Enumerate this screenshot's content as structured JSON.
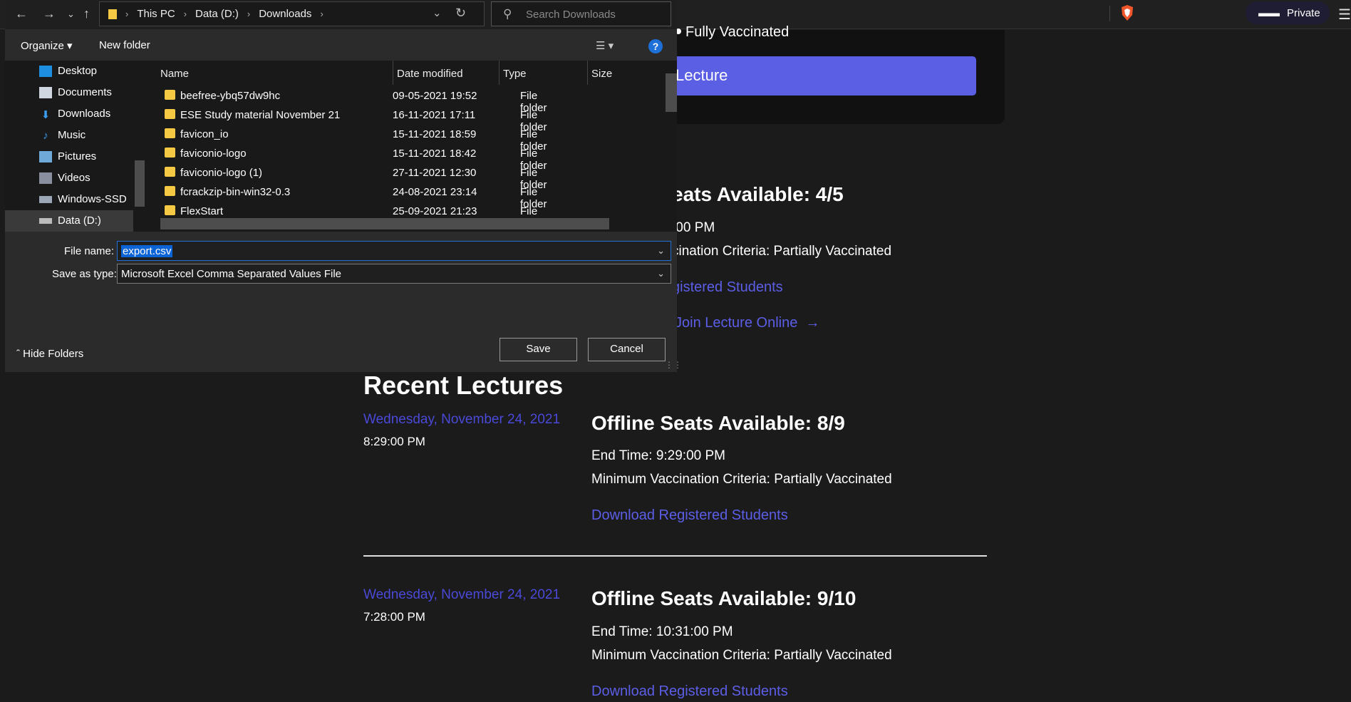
{
  "browser": {
    "private_label": "Private"
  },
  "page": {
    "partial_status": "Fully Vaccinated",
    "lecture_button": "Lecture",
    "upcoming": {
      "seats": "eats Available: 4/5",
      "end_time": ":00 PM",
      "criteria": "cination Criteria: Partially Vaccinated",
      "download": "gistered Students",
      "join": "Join Lecture Online"
    },
    "recent_title": "Recent Lectures",
    "lectures": [
      {
        "date": "Wednesday, November 24, 2021",
        "time": "8:29:00 PM",
        "seats": "Offline Seats Available: 8/9",
        "end_time": "End Time: 9:29:00 PM",
        "criteria": "Minimum Vaccination Criteria: Partially Vaccinated",
        "download": "Download Registered Students"
      },
      {
        "date": "Wednesday, November 24, 2021",
        "time": "7:28:00 PM",
        "seats": "Offline Seats Available: 9/10",
        "end_time": "End Time: 10:31:00 PM",
        "criteria": "Minimum Vaccination Criteria: Partially Vaccinated",
        "download": "Download Registered Students"
      }
    ]
  },
  "dialog": {
    "breadcrumb": [
      "This PC",
      "Data (D:)",
      "Downloads"
    ],
    "search_placeholder": "Search Downloads",
    "toolbar": {
      "organize": "Organize",
      "new_folder": "New folder"
    },
    "tree": [
      "Desktop",
      "Documents",
      "Downloads",
      "Music",
      "Pictures",
      "Videos",
      "Windows-SSD",
      "Data (D:)"
    ],
    "columns": [
      "Name",
      "Date modified",
      "Type",
      "Size"
    ],
    "files": [
      {
        "name": "beefree-ybq57dw9hc",
        "date": "09-05-2021 19:52",
        "type": "File folder"
      },
      {
        "name": "ESE Study material November 21",
        "date": "16-11-2021 17:11",
        "type": "File folder"
      },
      {
        "name": "favicon_io",
        "date": "15-11-2021 18:59",
        "type": "File folder"
      },
      {
        "name": "faviconio-logo",
        "date": "15-11-2021 18:42",
        "type": "File folder"
      },
      {
        "name": "faviconio-logo (1)",
        "date": "27-11-2021 12:30",
        "type": "File folder"
      },
      {
        "name": "fcrackzip-bin-win32-0.3",
        "date": "24-08-2021 23:14",
        "type": "File folder"
      },
      {
        "name": "FlexStart",
        "date": "25-09-2021 21:23",
        "type": "File folder"
      }
    ],
    "file_name_label": "File name:",
    "file_name_value": "export.csv",
    "save_type_label": "Save as type:",
    "save_type_value": "Microsoft Excel Comma Separated Values File",
    "save": "Save",
    "cancel": "Cancel",
    "hide_folders": "Hide Folders",
    "accent": "#0a64d6"
  }
}
